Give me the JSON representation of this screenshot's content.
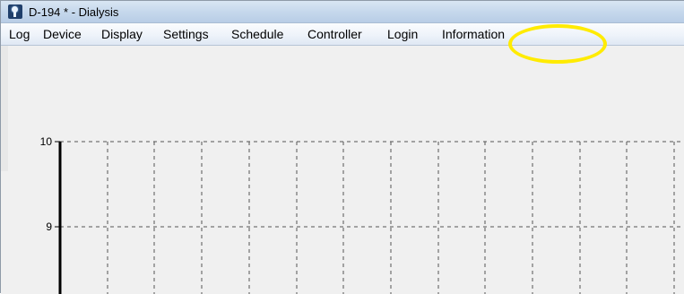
{
  "window": {
    "title": "D-194 * - Dialysis",
    "icon": "lightbulb-app-icon"
  },
  "menu": {
    "items": [
      "Log",
      "Device",
      "Display",
      "Settings",
      "Schedule",
      "Controller",
      "Login",
      "Information"
    ],
    "highlighted": "Information",
    "highlight_color": "#ffeb00"
  },
  "chart_data": {
    "type": "line",
    "series": [],
    "y_tick_labels": [
      "10",
      "9"
    ],
    "ylim_visible": [
      8,
      10
    ],
    "grid": "dashed",
    "xlabel": "",
    "ylabel": ""
  }
}
